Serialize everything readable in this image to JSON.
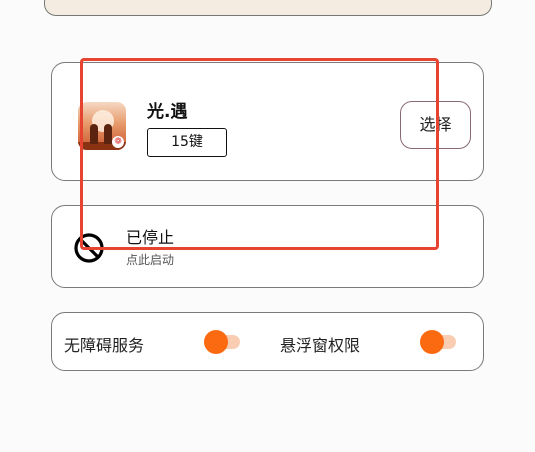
{
  "game": {
    "title": "光.遇",
    "key_mode": "15键",
    "select_label": "选择",
    "icon": "sky-game-icon"
  },
  "status": {
    "title": "已停止",
    "subtitle": "点此启动",
    "icon": "stopped-icon"
  },
  "permissions": {
    "accessibility_label": "无障碍服务",
    "accessibility_on": true,
    "floating_label": "悬浮窗权限",
    "floating_on": true
  },
  "colors": {
    "accent": "#fb6a10",
    "toggle_track": "#f9cdb2",
    "highlight_box": "#e64430",
    "banner": "#f4ece0"
  }
}
